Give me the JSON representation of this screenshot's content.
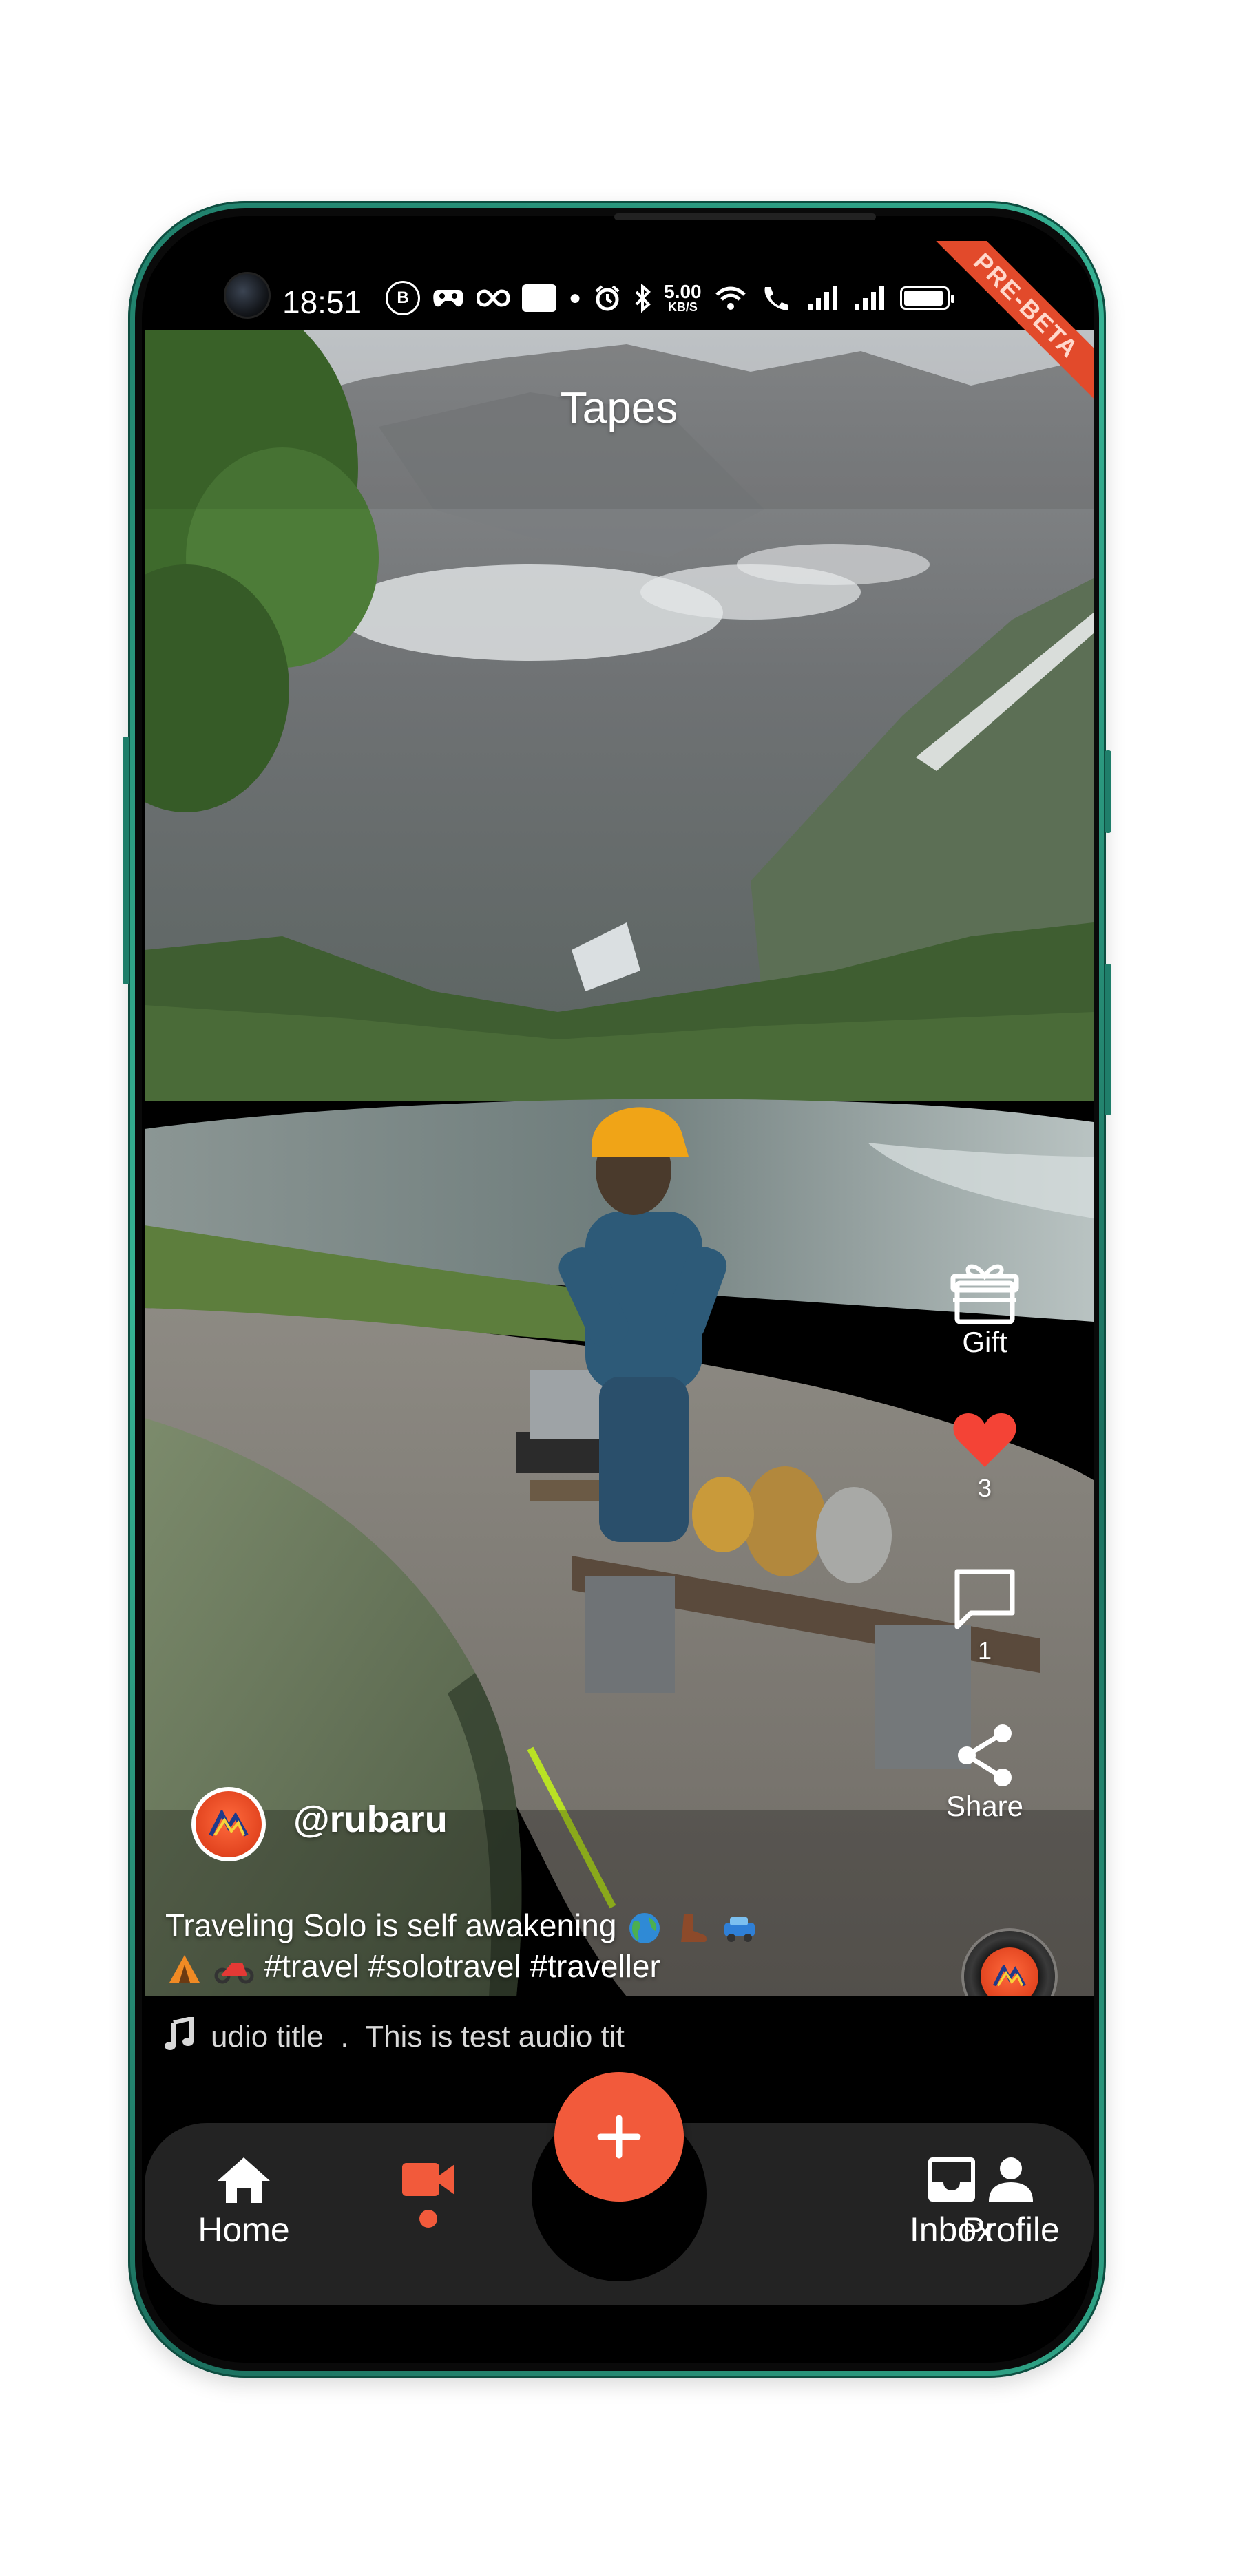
{
  "status_bar": {
    "time": "18:51",
    "icons": [
      "b-circle-icon",
      "game-icon",
      "infinity-icon",
      "note-icon",
      "dot-icon",
      "alarm-icon",
      "bluetooth-icon",
      "wifi-icon",
      "call-icon",
      "signal-icon",
      "signal-icon",
      "battery-icon"
    ],
    "speed_value": "5.00",
    "speed_unit": "KB/S",
    "battery_level": 0.95
  },
  "ribbon": {
    "label": "PRE-BETA",
    "color": "#e24a2b"
  },
  "header": {
    "title": "Tapes"
  },
  "actions": {
    "gift": {
      "label": "Gift",
      "icon": "gift-icon"
    },
    "like": {
      "count": "3",
      "icon": "heart-icon",
      "color": "#f44336"
    },
    "comment": {
      "count": "1",
      "icon": "comment-icon"
    },
    "share": {
      "label": "Share",
      "icon": "share-icon"
    }
  },
  "post": {
    "username": "@rubaru",
    "caption_line1": "Traveling Solo is self awakening",
    "caption_line2": "#travel #solotravel #traveller",
    "emojis_line1": [
      "globe-emoji",
      "boot-emoji",
      "car-emoji"
    ],
    "emojis_line2": [
      "tent-emoji",
      "motorcycle-emoji"
    ]
  },
  "audio": {
    "icon": "music-note-icon",
    "title": "udio title  .  This is test audio tit"
  },
  "nav": {
    "items": [
      {
        "label": "Home",
        "icon": "home-icon"
      },
      {
        "label": "",
        "icon": "video-camera-icon",
        "active": true
      },
      {
        "label": "Inbox",
        "icon": "inbox-icon"
      },
      {
        "label": "Profile",
        "icon": "person-icon"
      }
    ],
    "fab_icon": "plus-icon",
    "accent": "#f25a3b"
  }
}
